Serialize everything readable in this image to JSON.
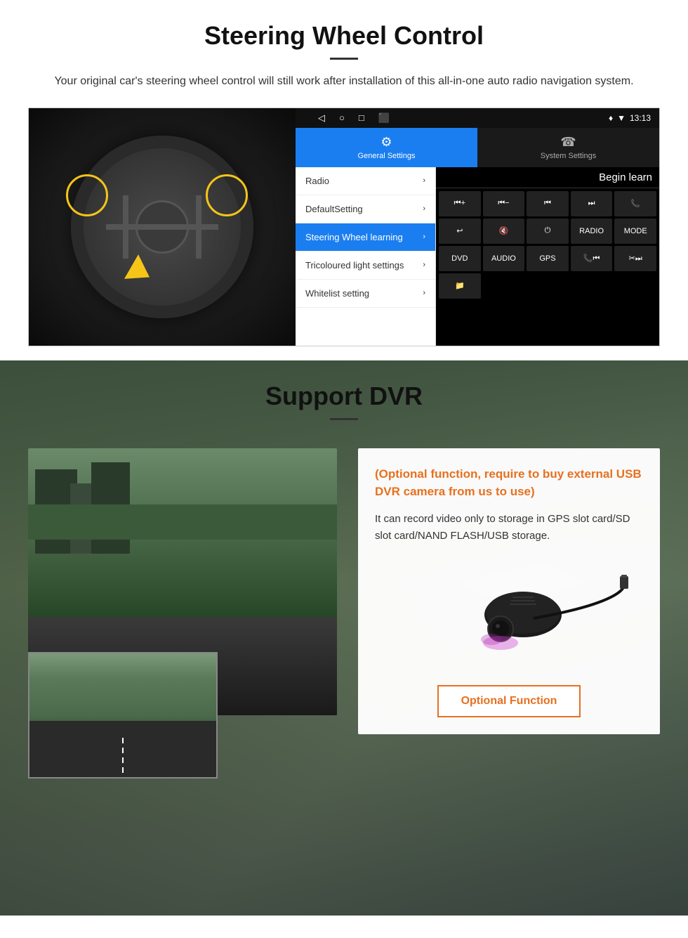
{
  "steering": {
    "title": "Steering Wheel Control",
    "subtitle": "Your original car's steering wheel control will still work after installation of this all-in-one auto radio navigation system.",
    "statusbar": {
      "time": "13:13",
      "nav": [
        "◁",
        "○",
        "□",
        "⬛"
      ]
    },
    "tabs": [
      {
        "icon": "⚙",
        "label": "General Settings",
        "active": true
      },
      {
        "icon": "☎",
        "label": "System Settings",
        "active": false
      }
    ],
    "menu": [
      {
        "label": "Radio",
        "active": false
      },
      {
        "label": "DefaultSetting",
        "active": false
      },
      {
        "label": "Steering Wheel learning",
        "active": true
      },
      {
        "label": "Tricoloured light settings",
        "active": false
      },
      {
        "label": "Whitelist setting",
        "active": false
      }
    ],
    "begin_learn": "Begin learn",
    "ctrl_buttons": [
      "⏮+",
      "⏮-",
      "⏮",
      "⏭",
      "📞",
      "↩",
      "🔇×",
      "⏻",
      "RADIO",
      "MODE",
      "DVD",
      "AUDIO",
      "GPS",
      "📞⏮",
      "✂⏭",
      "📁"
    ]
  },
  "dvr": {
    "title": "Support DVR",
    "optional_text": "(Optional function, require to buy external USB DVR camera from us to use)",
    "description": "It can record video only to storage in GPS slot card/SD slot card/NAND FLASH/USB storage.",
    "optional_button": "Optional Function"
  }
}
